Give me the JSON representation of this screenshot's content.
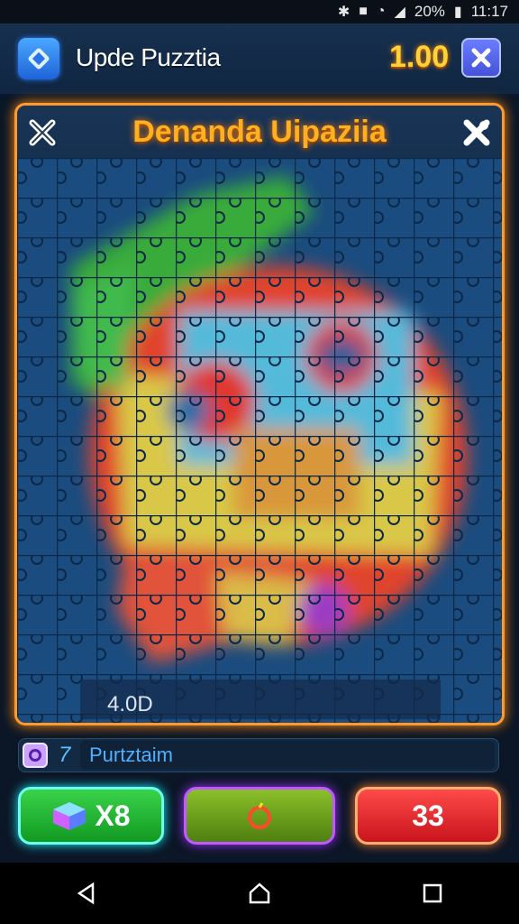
{
  "status": {
    "percent": "20%",
    "time": "11:17"
  },
  "header": {
    "title": "Upde Puzztia",
    "score": "1.00"
  },
  "board": {
    "title": "Denanda Uipaziia",
    "moves": "4.0D"
  },
  "info": {
    "number": "7",
    "text": "Purtztaim"
  },
  "buttons": {
    "left": "X8",
    "right": "33"
  },
  "icons": [
    "bluetooth-icon",
    "lock-icon",
    "wifi-icon",
    "signal-icon",
    "battery-icon",
    "app-puzzle-icon",
    "close-icon",
    "shuffle-icon",
    "hint-icon",
    "cube-icon",
    "bomb-icon",
    "back-icon",
    "home-icon",
    "recents-icon"
  ],
  "colors": {
    "frame": "#ff9a2a",
    "title": "#ffb020",
    "score": "#ffd23a",
    "board_bg": "#1c4b7c"
  }
}
